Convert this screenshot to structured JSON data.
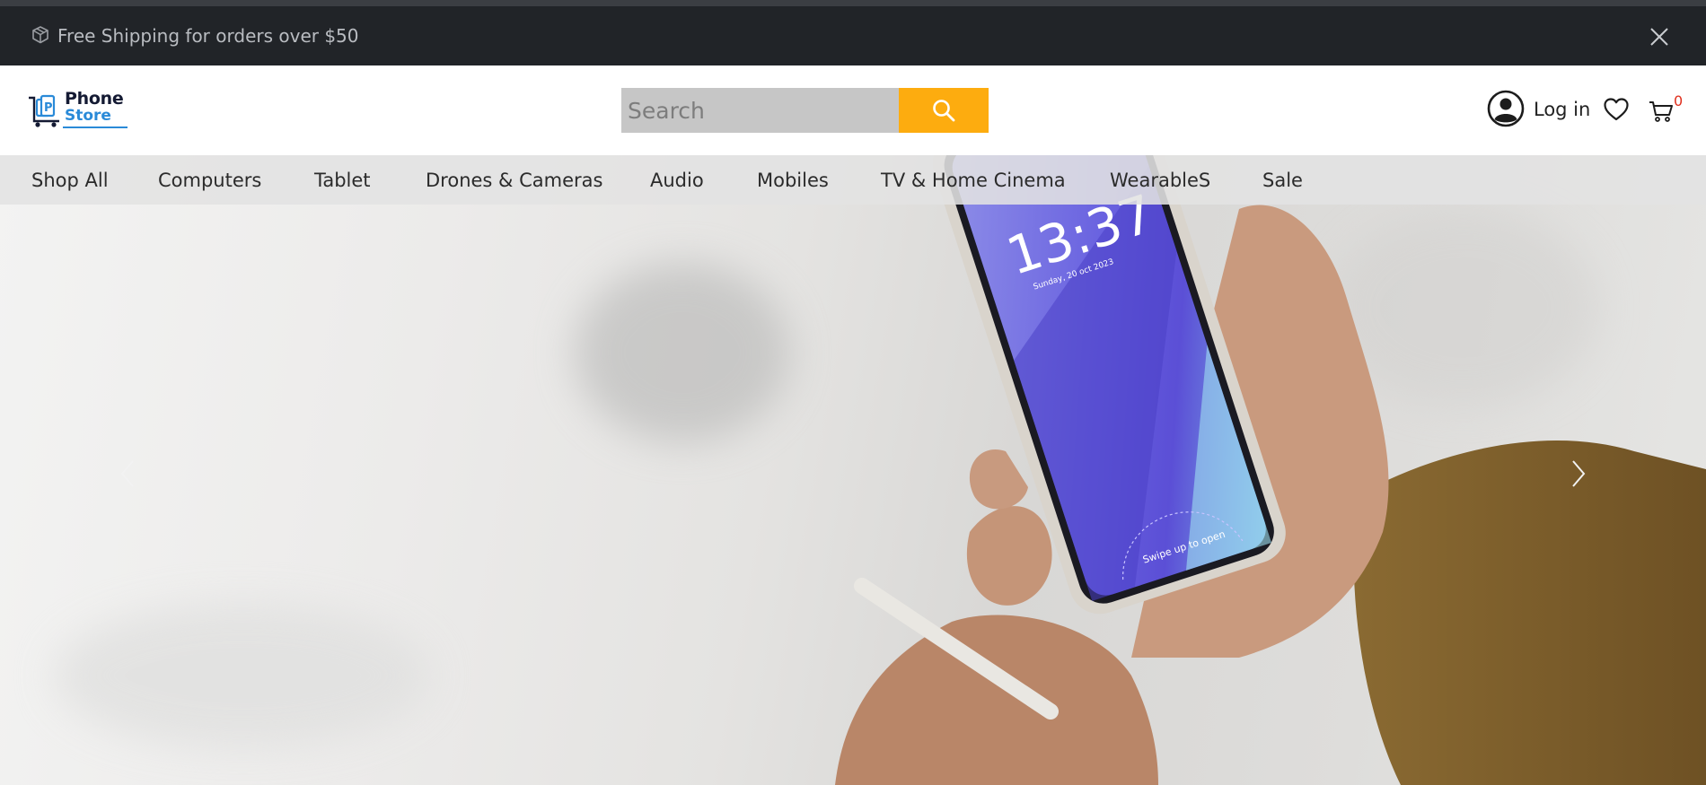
{
  "announcement": {
    "text": "Free Shipping for orders over $50",
    "icon": "package-icon",
    "close_icon": "close-icon"
  },
  "header": {
    "logo": {
      "word1": "Phone",
      "word2": "Store",
      "brand_color": "#2a8ad8",
      "text_color": "#141a33"
    },
    "search": {
      "placeholder": "Search",
      "button_icon": "search-icon",
      "button_color": "#fdac0f"
    },
    "account": {
      "login_label": "Log in",
      "icon": "user-circle-icon"
    },
    "wishlist_icon": "heart-icon",
    "cart": {
      "icon": "cart-icon",
      "count": "0",
      "count_color": "#e0301e"
    }
  },
  "nav": {
    "items": [
      {
        "label": "Shop All"
      },
      {
        "label": "Computers"
      },
      {
        "label": "Tablet"
      },
      {
        "label": "Drones & Cameras"
      },
      {
        "label": "Audio"
      },
      {
        "label": "Mobiles"
      },
      {
        "label": "TV & Home Cinema"
      },
      {
        "label": "WearableS"
      },
      {
        "label": "Sale"
      }
    ]
  },
  "hero": {
    "phone_time": "13:37",
    "phone_date": "Sunday, 20 oct 2023",
    "phone_swipe": "Swipe up to open",
    "prev_icon": "chevron-left-icon",
    "next_icon": "chevron-right-icon"
  },
  "colors": {
    "announcement_bg": "#212428",
    "announcement_text": "#b9bcc1",
    "nav_bg": "#e2e2e2",
    "search_bg": "#c6c6c6"
  }
}
